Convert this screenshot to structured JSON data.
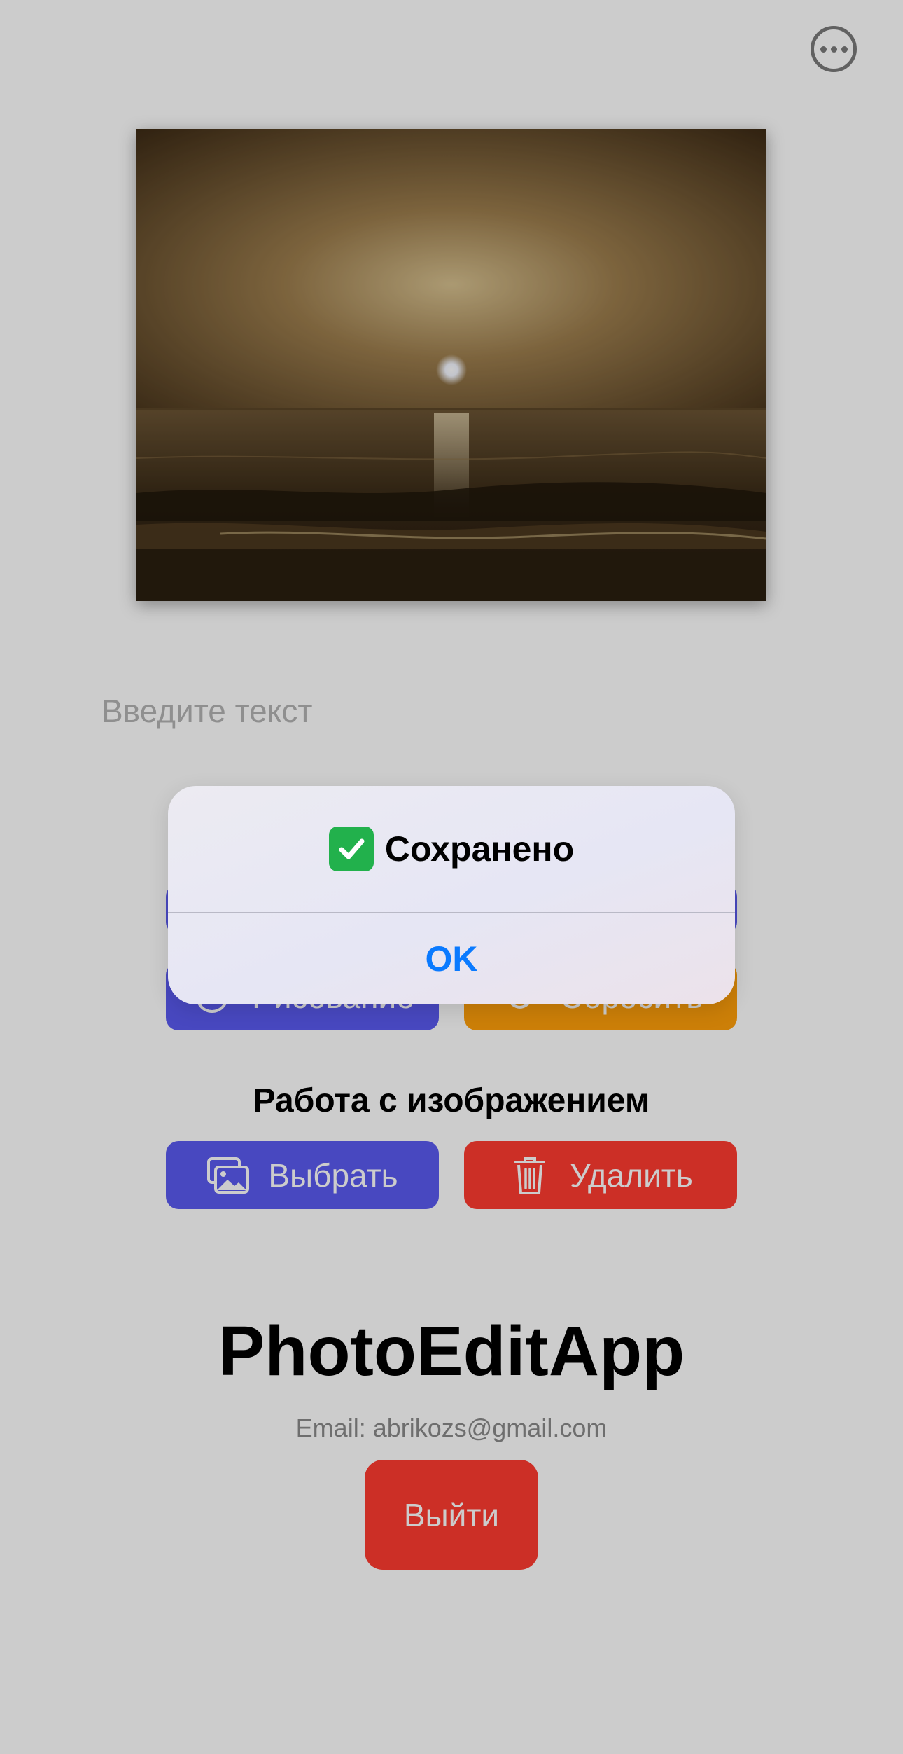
{
  "app": {
    "name": "PhotoEditApp",
    "email": "Email: abrikozs@gmail.com",
    "logout_label": "Выйти"
  },
  "editor": {
    "text_placeholder": "Введите текст",
    "text_value": "",
    "draw_label": "Рисование",
    "reset_label": "Сбросить"
  },
  "image_section": {
    "title": "Работа с изображением",
    "pick_label": "Выбрать",
    "delete_label": "Удалить"
  },
  "alert": {
    "message": "Сохранено",
    "ok_label": "OK"
  },
  "icons": {
    "more": "ellipsis-circle-icon",
    "draw": "palette-icon",
    "reset": "undo-arrow-icon",
    "pick": "photo-stack-icon",
    "delete": "trash-icon",
    "check": "check-mark-emoji"
  },
  "colors": {
    "blue": "#5b5bf0",
    "orange": "#ff9f0a",
    "red": "#ff3b30",
    "link": "#0a7aff",
    "check": "#22b14c"
  }
}
